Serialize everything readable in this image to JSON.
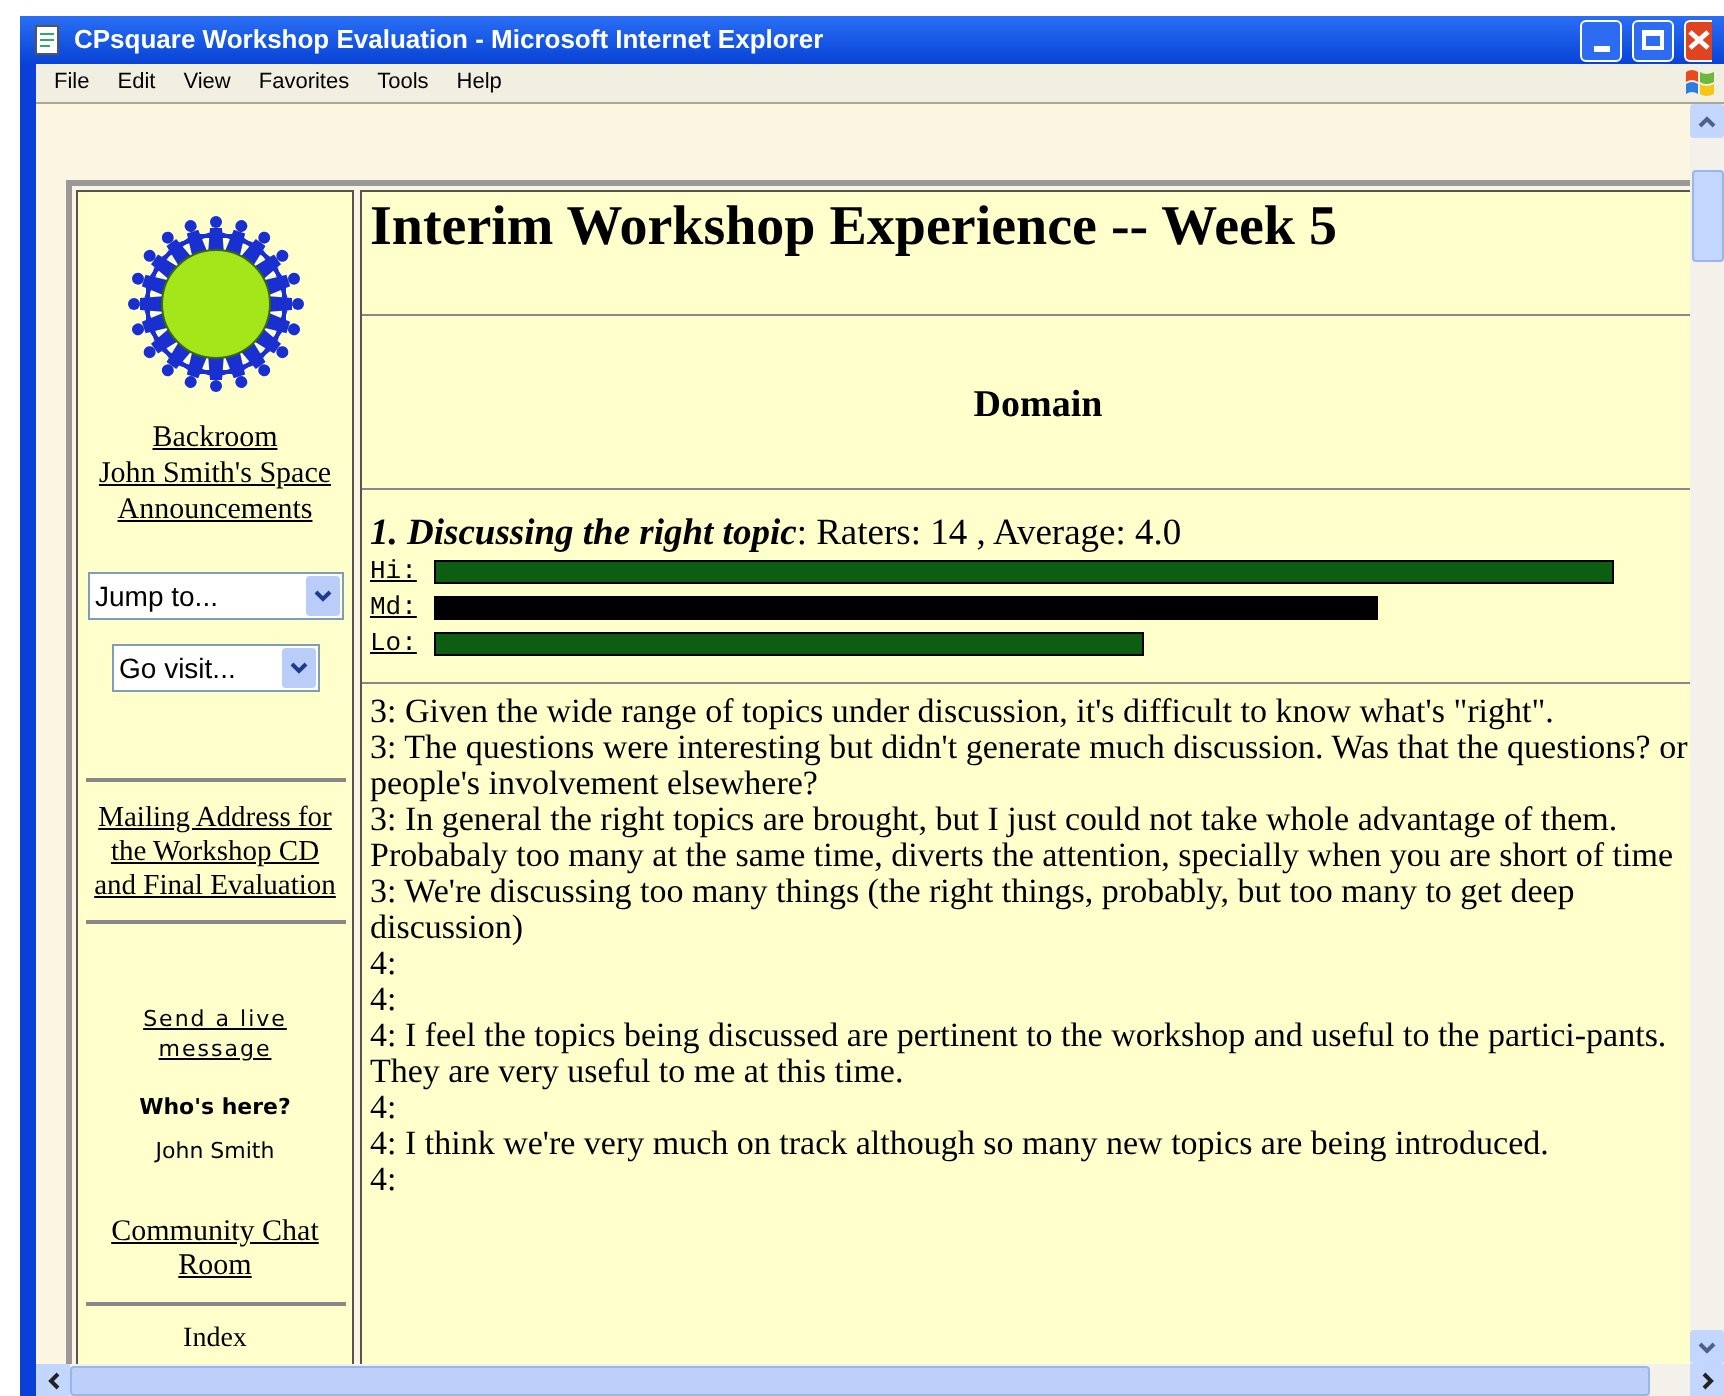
{
  "window": {
    "title": "CPsquare Workshop Evaluation - Microsoft Internet Explorer"
  },
  "menu": [
    "File",
    "Edit",
    "View",
    "Favorites",
    "Tools",
    "Help"
  ],
  "sidebar": {
    "links": [
      "Backroom",
      "John Smith's Space",
      "Announcements"
    ],
    "selects": [
      {
        "value": "Jump to..."
      },
      {
        "value": "Go visit..."
      }
    ],
    "mailing_link": "Mailing Address for the Workshop CD and Final Evaluation",
    "live_message_link": "Send a live message",
    "whos_here": {
      "heading": "Who's here?",
      "users": [
        "John Smith"
      ]
    },
    "chat_link": "Community Chat Room",
    "index_link": "Index"
  },
  "main": {
    "title": "Interim Workshop Experience -- Week 5",
    "section": "Domain",
    "question": {
      "title": "1. Discussing the right topic",
      "stats": ": Raters: 14 , Average: 4.0"
    },
    "ratings": [
      {
        "label": "Hi:",
        "color": "#0d5e12"
      },
      {
        "label": "Md:",
        "color": "#000000"
      },
      {
        "label": "Lo:",
        "color": "#0d5e12"
      }
    ],
    "comments": [
      "3: Given the wide range of topics under discussion, it's difficult to know what's \"right\".",
      "3: The questions were interesting but didn't generate much discussion. Was that the questions? or people's involvement elsewhere?",
      "3: In general the right topics are brought, but I just could not take whole advantage of them. Probabaly too many at the same time, diverts the attention, specially when you are short of time",
      "3: We're discussing too many things (the right things, probably, but too many to get deep discussion)",
      "4:",
      "4:",
      "4: I feel the topics being discussed are pertinent to the workshop and useful to the partici-pants. They are very useful to me at this time.",
      "4:",
      "4: I think we're very much on track although so many new topics are being introduced.",
      "4:"
    ]
  }
}
